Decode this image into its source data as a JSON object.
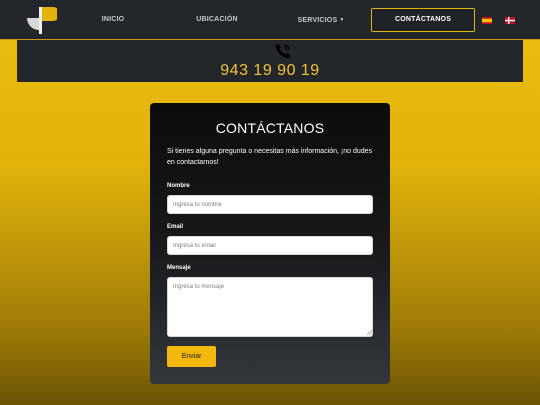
{
  "nav": {
    "items": [
      {
        "label": "INICIO"
      },
      {
        "label": "UBICACIÓN"
      },
      {
        "label": "SERVICIOS",
        "has_dropdown": true
      },
      {
        "label": "CONTÁCTANOS",
        "active": true
      }
    ],
    "flags": [
      "spain-flag-icon",
      "denmark-flag-icon"
    ]
  },
  "contact_bar": {
    "icon": "phone-icon",
    "phone": "943 19 90 19"
  },
  "form": {
    "title": "CONTÁCTANOS",
    "intro": "Si tienes alguna pregunta o necesitas más información, ¡no dudes en contactarnos!",
    "name_label": "Nombre",
    "name_placeholder": "Ingresa tu nombre",
    "email_label": "Email",
    "email_placeholder": "Ingresa tu email",
    "message_label": "Mensaje",
    "message_placeholder": "Ingresa tu mensaje",
    "submit_label": "Enviar"
  },
  "colors": {
    "accent": "#f3b80d",
    "nav_bg": "#23272c",
    "phone_text": "#f3c233"
  }
}
